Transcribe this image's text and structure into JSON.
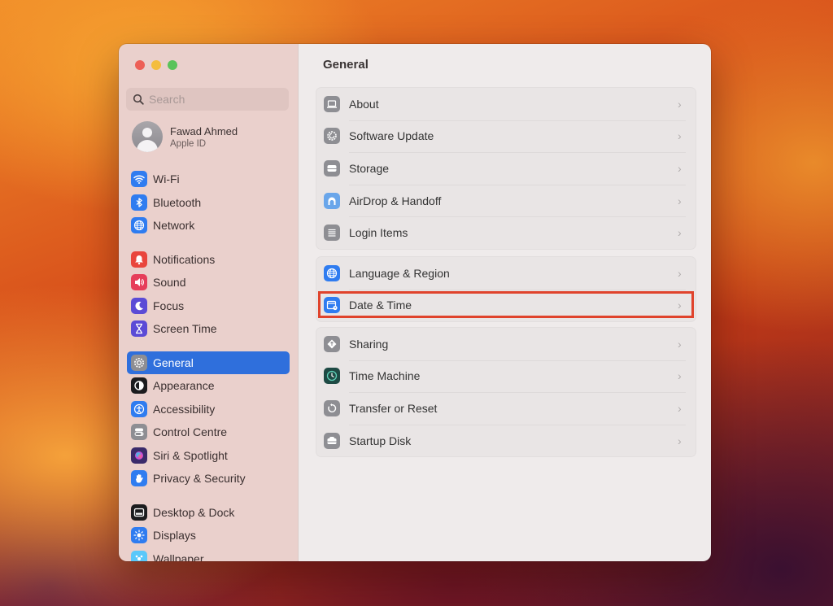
{
  "window": {
    "traffic_lights": [
      "close",
      "minimize",
      "maximize"
    ]
  },
  "sidebar": {
    "search": {
      "placeholder": "Search",
      "value": ""
    },
    "user": {
      "name": "Fawad Ahmed",
      "subtitle": "Apple ID"
    },
    "groups": [
      [
        {
          "label": "Wi-Fi",
          "icon": "wifi-icon",
          "color": "#2f7cf0"
        },
        {
          "label": "Bluetooth",
          "icon": "bluetooth-icon",
          "color": "#2f7cf0"
        },
        {
          "label": "Network",
          "icon": "globe-icon",
          "color": "#2f7cf0"
        }
      ],
      [
        {
          "label": "Notifications",
          "icon": "bell-icon",
          "color": "#e9463d"
        },
        {
          "label": "Sound",
          "icon": "speaker-icon",
          "color": "#e63e5a"
        },
        {
          "label": "Focus",
          "icon": "moon-icon",
          "color": "#5b4bd6"
        },
        {
          "label": "Screen Time",
          "icon": "hourglass-icon",
          "color": "#5b4bd6"
        }
      ],
      [
        {
          "label": "General",
          "icon": "gear-icon",
          "color": "#8e8e93",
          "selected": true
        },
        {
          "label": "Appearance",
          "icon": "appearance-icon",
          "color": "#1c1c1e"
        },
        {
          "label": "Accessibility",
          "icon": "accessibility-icon",
          "color": "#2f7cf0"
        },
        {
          "label": "Control Centre",
          "icon": "toggles-icon",
          "color": "#8e8e93"
        },
        {
          "label": "Siri & Spotlight",
          "icon": "siri-icon",
          "color": "#3a2a6a"
        },
        {
          "label": "Privacy & Security",
          "icon": "hand-icon",
          "color": "#2f7cf0"
        }
      ],
      [
        {
          "label": "Desktop & Dock",
          "icon": "dock-icon",
          "color": "#1c1c1e"
        },
        {
          "label": "Displays",
          "icon": "sun-icon",
          "color": "#2f7cf0"
        },
        {
          "label": "Wallpaper",
          "icon": "wallpaper-icon",
          "color": "#5ac8fa"
        }
      ]
    ]
  },
  "main": {
    "title": "General",
    "groups": [
      [
        {
          "label": "About",
          "icon": "laptop-icon",
          "color": "#8e8e93"
        },
        {
          "label": "Software Update",
          "icon": "gear-update-icon",
          "color": "#8e8e93"
        },
        {
          "label": "Storage",
          "icon": "drive-icon",
          "color": "#8e8e93"
        },
        {
          "label": "AirDrop & Handoff",
          "icon": "airdrop-icon",
          "color": "#6aa6ea"
        },
        {
          "label": "Login Items",
          "icon": "list-icon",
          "color": "#8e8e93"
        }
      ],
      [
        {
          "label": "Language & Region",
          "icon": "globe-icon",
          "color": "#2f7cf0"
        },
        {
          "label": "Date & Time",
          "icon": "calendar-clock-icon",
          "color": "#2f7cf0",
          "highlighted": true
        }
      ],
      [
        {
          "label": "Sharing",
          "icon": "sharing-icon",
          "color": "#8e8e93"
        },
        {
          "label": "Time Machine",
          "icon": "time-machine-icon",
          "color": "#1e4a44"
        },
        {
          "label": "Transfer or Reset",
          "icon": "reset-icon",
          "color": "#8e8e93"
        },
        {
          "label": "Startup Disk",
          "icon": "disk-icon",
          "color": "#8e8e93"
        }
      ]
    ],
    "highlight_color": "#e0432c"
  }
}
